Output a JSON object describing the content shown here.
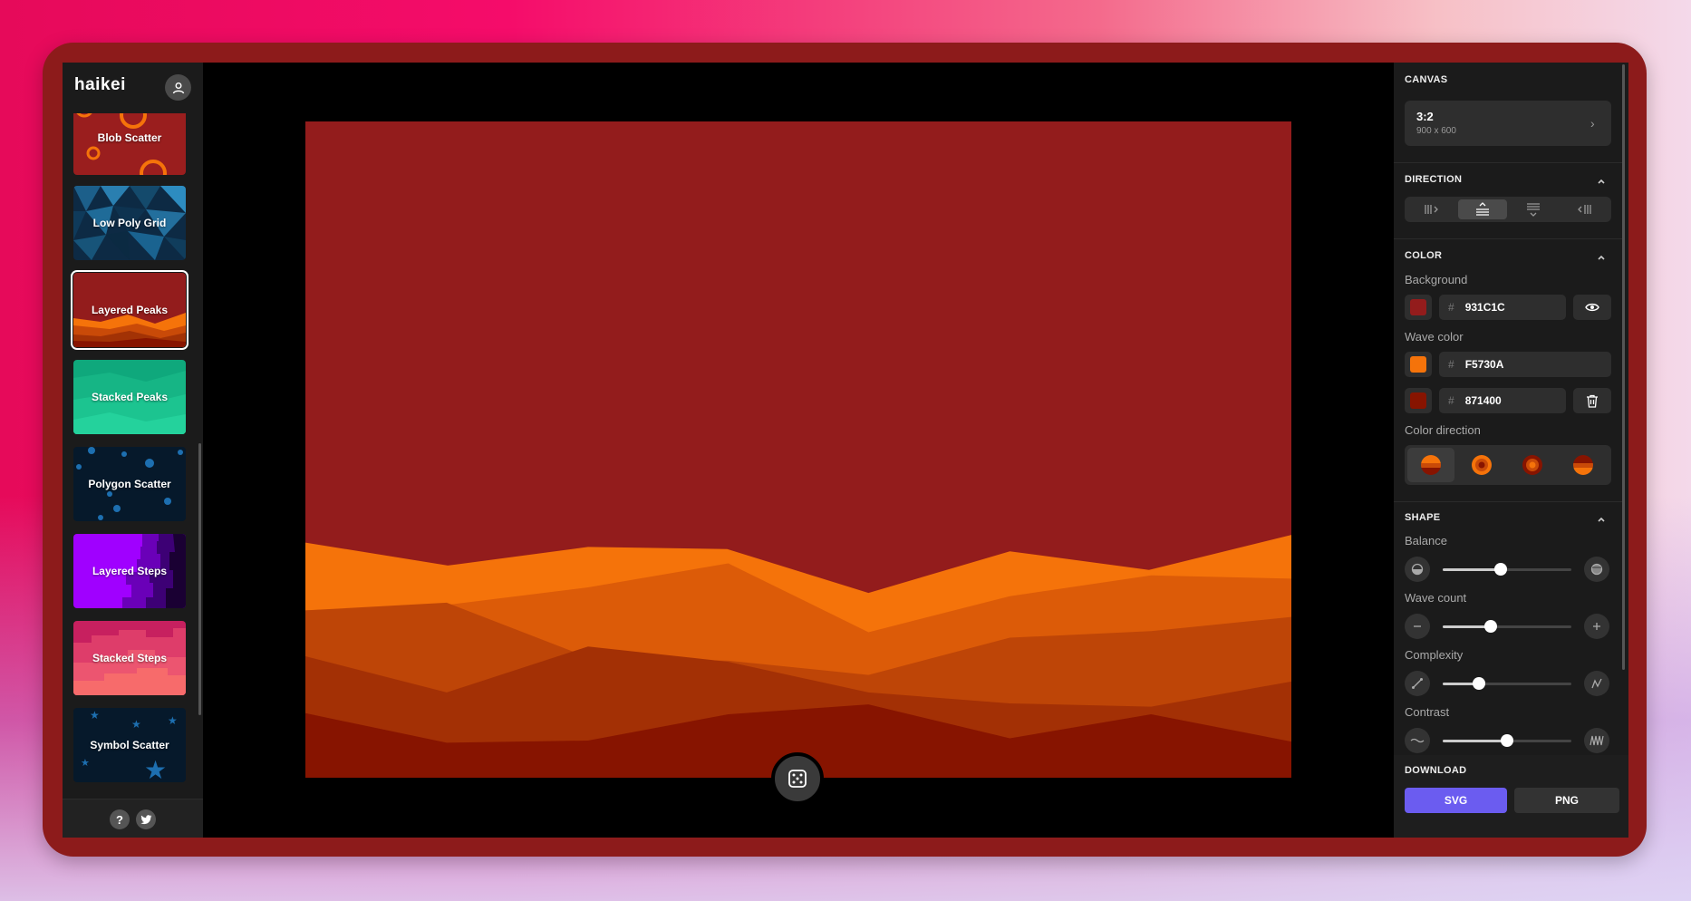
{
  "app": {
    "logo": "haikei"
  },
  "sidebar": {
    "items": [
      {
        "label": "Blob Scatter",
        "selected": false
      },
      {
        "label": "Low Poly Grid",
        "selected": false
      },
      {
        "label": "Layered Peaks",
        "selected": true
      },
      {
        "label": "Stacked Peaks",
        "selected": false
      },
      {
        "label": "Polygon Scatter",
        "selected": false
      },
      {
        "label": "Layered Steps",
        "selected": false
      },
      {
        "label": "Stacked Steps",
        "selected": false
      },
      {
        "label": "Symbol Scatter",
        "selected": false
      }
    ],
    "help_label": "?"
  },
  "panel": {
    "canvas": {
      "title": "CANVAS",
      "ratio": "3:2",
      "size": "900 x 600"
    },
    "direction": {
      "title": "DIRECTION",
      "selected_index": 1
    },
    "color": {
      "title": "COLOR",
      "background_label": "Background",
      "background": "931C1C",
      "wave_label": "Wave color",
      "wave_colors": [
        "F5730A",
        "871400"
      ],
      "hash": "#",
      "direction_label": "Color direction",
      "direction_selected_index": 0
    },
    "shape": {
      "title": "SHAPE",
      "sliders": [
        {
          "label": "Balance",
          "value": 0.45
        },
        {
          "label": "Wave count",
          "value": 0.37
        },
        {
          "label": "Complexity",
          "value": 0.28
        },
        {
          "label": "Contrast",
          "value": 0.5
        }
      ]
    },
    "download": {
      "title": "DOWNLOAD",
      "svg_label": "SVG",
      "png_label": "PNG"
    }
  },
  "colors": {
    "background": "#931C1C",
    "wave_top": "#F5730A",
    "wave_bottom": "#871400",
    "accent": "#6b5cf0"
  }
}
